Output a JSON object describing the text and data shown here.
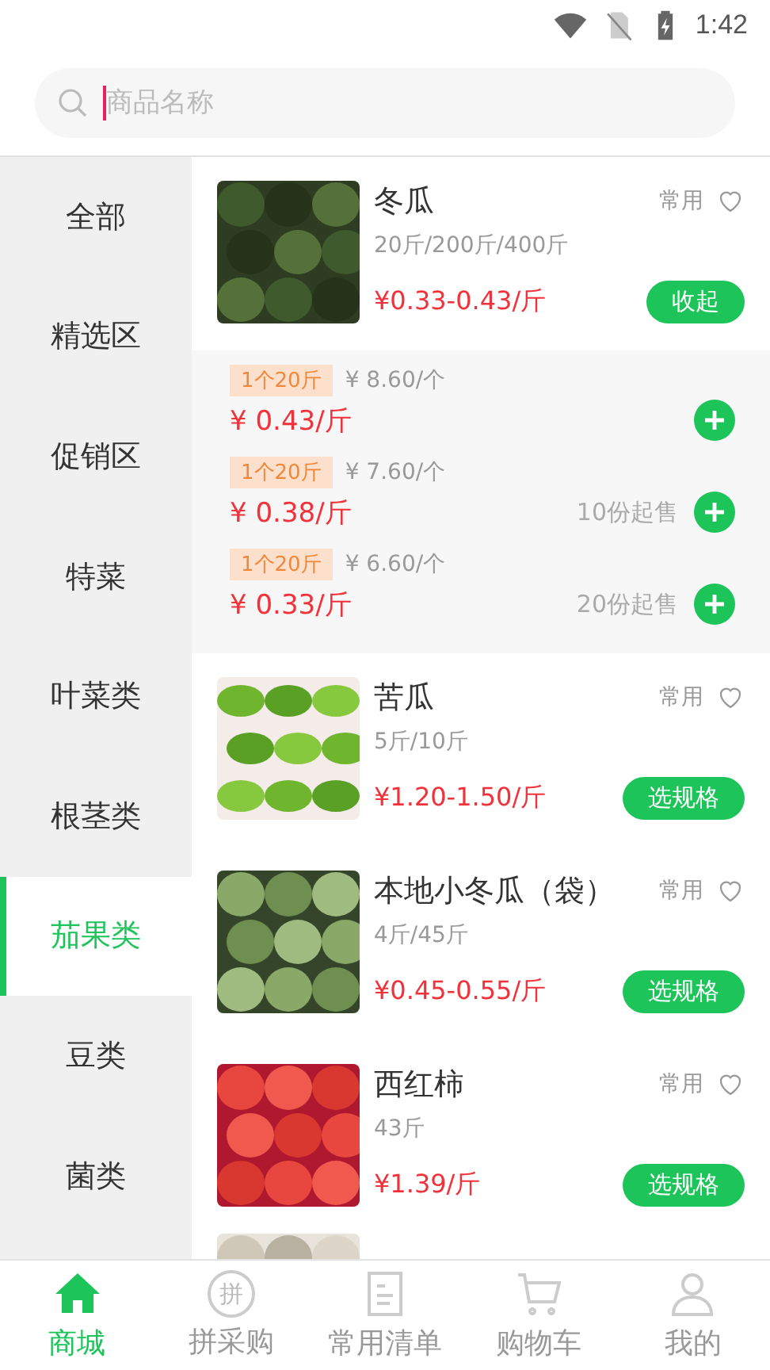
{
  "status_bar": {
    "time": "1:42"
  },
  "search": {
    "placeholder": "商品名称"
  },
  "categories": [
    {
      "label": "全部",
      "selected": false
    },
    {
      "label": "精选区",
      "selected": false
    },
    {
      "label": "促销区",
      "selected": false
    },
    {
      "label": "特菜",
      "selected": false
    },
    {
      "label": "叶菜类",
      "selected": false
    },
    {
      "label": "根茎类",
      "selected": false
    },
    {
      "label": "茄果类",
      "selected": true
    },
    {
      "label": "豆类",
      "selected": false
    },
    {
      "label": "菌类",
      "selected": false
    }
  ],
  "products": [
    {
      "name": "冬瓜",
      "specs": "20斤/200斤/400斤",
      "price": "¥0.33-0.43/斤",
      "tag": "常用",
      "favorite": false,
      "button": "收起",
      "options": [
        {
          "size": "1个20斤",
          "unit_price": "¥ 8.60/个",
          "price": "¥ 0.43/斤"
        },
        {
          "size": "1个20斤",
          "unit_price": "¥ 7.60/个",
          "price": "¥ 0.38/斤",
          "min_order": "10份起售"
        },
        {
          "size": "1个20斤",
          "unit_price": "¥ 6.60/个",
          "price": "¥ 0.33/斤",
          "min_order": "20份起售"
        }
      ]
    },
    {
      "name": "苦瓜",
      "specs": "5斤/10斤",
      "price": "¥1.20-1.50/斤",
      "tag": "常用",
      "favorite": false,
      "button": "选规格"
    },
    {
      "name": "本地小冬瓜（袋）",
      "specs": "4斤/45斤",
      "price": "¥0.45-0.55/斤",
      "tag": "常用",
      "favorite": false,
      "button": "选规格"
    },
    {
      "name": "西红柿",
      "specs": "43斤",
      "price": "¥1.39/斤",
      "tag": "常用",
      "favorite": false,
      "button": "选规格"
    }
  ],
  "tab_bar": [
    {
      "label": "商城",
      "selected": true,
      "kind": "home"
    },
    {
      "label": "拼采购",
      "selected": false,
      "kind": "badge",
      "icon_text": "拼"
    },
    {
      "label": "常用清单",
      "selected": false,
      "kind": "list"
    },
    {
      "label": "购物车",
      "selected": false,
      "kind": "cart"
    },
    {
      "label": "我的",
      "selected": false,
      "kind": "person"
    }
  ]
}
